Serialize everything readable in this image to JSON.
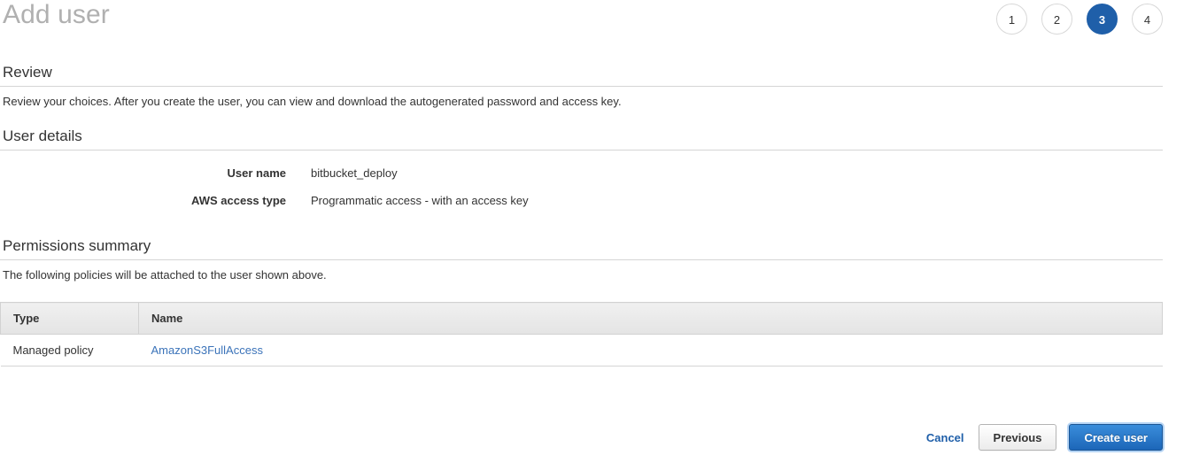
{
  "header": {
    "title": "Add user",
    "steps": [
      {
        "label": "1",
        "active": false
      },
      {
        "label": "2",
        "active": false
      },
      {
        "label": "3",
        "active": true
      },
      {
        "label": "4",
        "active": false
      }
    ]
  },
  "review": {
    "title": "Review",
    "description": "Review your choices. After you create the user, you can view and download the autogenerated password and access key."
  },
  "user_details": {
    "title": "User details",
    "rows": [
      {
        "label": "User name",
        "value": "bitbucket_deploy"
      },
      {
        "label": "AWS access type",
        "value": "Programmatic access - with an access key"
      }
    ]
  },
  "permissions": {
    "title": "Permissions summary",
    "description": "The following policies will be attached to the user shown above.",
    "table": {
      "columns": [
        "Type",
        "Name"
      ],
      "rows": [
        {
          "type": "Managed policy",
          "name": "AmazonS3FullAccess"
        }
      ]
    }
  },
  "footer": {
    "cancel_label": "Cancel",
    "previous_label": "Previous",
    "create_label": "Create user"
  },
  "colors": {
    "accent_blue": "#1f5fa9",
    "link_blue": "#3b73b9",
    "title_grey": "#b0b0b0",
    "rule_grey": "#d5d5d5",
    "table_header_grey": "#e9e9e9"
  }
}
